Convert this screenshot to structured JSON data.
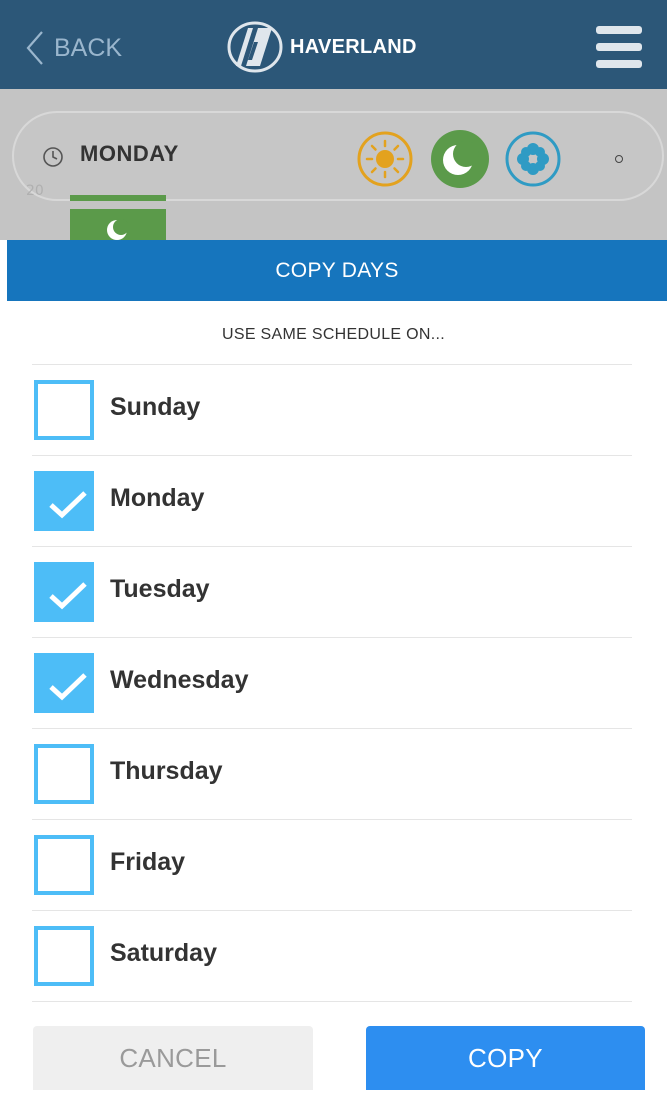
{
  "header": {
    "back_label": "BACK",
    "brand": "HAVERLAND",
    "icons": {
      "back": "chevron-left-icon",
      "logo": "haverland-logo-icon",
      "menu": "hamburger-menu-icon"
    }
  },
  "background": {
    "day_name": "MONDAY",
    "partial_label": "20",
    "icons": [
      "clock-icon",
      "sun-icon",
      "moon-icon",
      "snowflake-icon",
      "dot-icon"
    ],
    "mode_colors": {
      "sun": "#e3a21e",
      "moon": "#5b9a4a",
      "snow": "#2f9bc4"
    }
  },
  "dialog": {
    "title": "COPY DAYS",
    "subtitle": "USE SAME SCHEDULE ON...",
    "days": [
      {
        "label": "Sunday",
        "checked": false
      },
      {
        "label": "Monday",
        "checked": true
      },
      {
        "label": "Tuesday",
        "checked": true
      },
      {
        "label": "Wednesday",
        "checked": true
      },
      {
        "label": "Thursday",
        "checked": false
      },
      {
        "label": "Friday",
        "checked": false
      },
      {
        "label": "Saturday",
        "checked": false
      }
    ],
    "cancel_label": "CANCEL",
    "copy_label": "COPY"
  },
  "colors": {
    "header_bg": "#2c5778",
    "title_bar": "#1675bd",
    "checkbox": "#4dbdf7",
    "copy_button": "#2d8ef0",
    "cancel_button": "#efefef"
  }
}
